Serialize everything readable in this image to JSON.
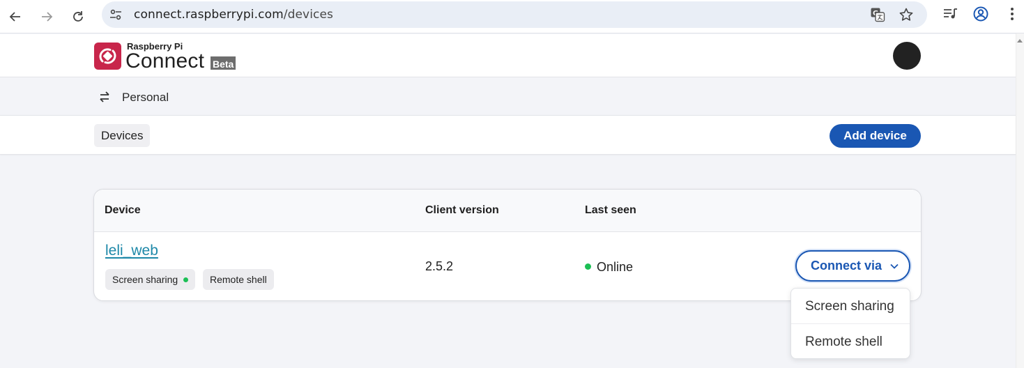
{
  "browser": {
    "url_host": "connect.raspberrypi.com",
    "url_path": "/devices",
    "icons": [
      "back-arrow-icon",
      "forward-arrow-icon",
      "reload-icon",
      "site-settings-icon",
      "translate-icon",
      "bookmark-star-icon",
      "reading-list-icon",
      "profile-icon",
      "menu-dots-icon"
    ]
  },
  "header": {
    "brand_small": "Raspberry Pi",
    "brand_big": "Connect",
    "beta_label": "Beta"
  },
  "workspace": {
    "name": "Personal"
  },
  "tabs": {
    "devices_label": "Devices",
    "add_device_label": "Add device"
  },
  "table": {
    "columns": [
      "Device",
      "Client version",
      "Last seen"
    ],
    "rows": [
      {
        "device": "leli_web",
        "tags": [
          "Screen sharing",
          "Remote shell"
        ],
        "client_version": "2.5.2",
        "last_seen": "Online"
      }
    ],
    "connect_label": "Connect via"
  },
  "dropdown": {
    "items": [
      "Screen sharing",
      "Remote shell"
    ]
  },
  "colors": {
    "accent_blue": "#1a57b3",
    "online_green": "#1cbf55",
    "brand_red": "#c8264b",
    "link_teal": "#1d88a8"
  }
}
